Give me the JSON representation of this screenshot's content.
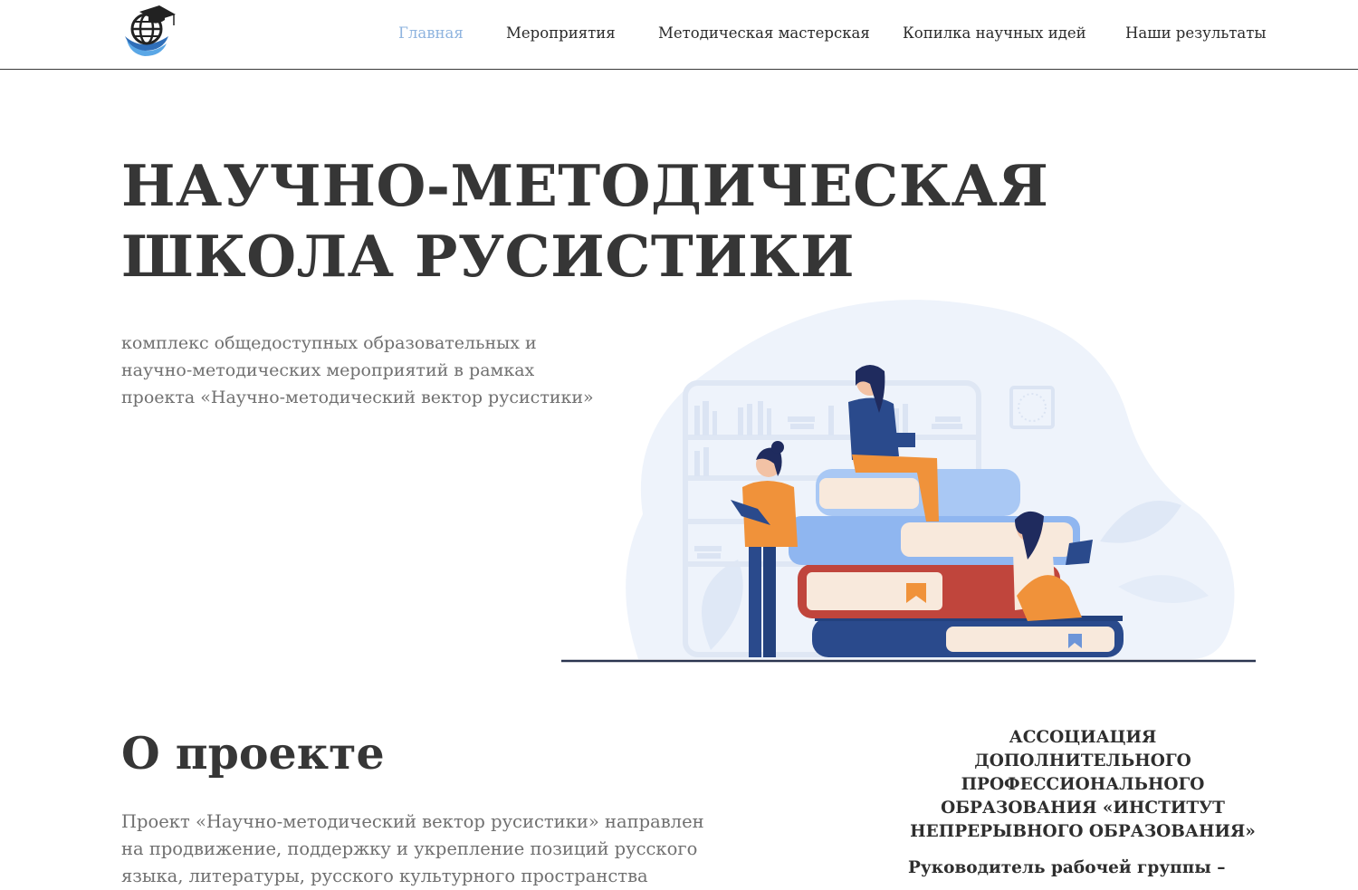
{
  "header": {
    "logo_icon": "globe-graduation-cap-icon",
    "nav": [
      {
        "label": "Главная",
        "active": true
      },
      {
        "label": "Мероприятия",
        "active": false
      },
      {
        "label": "Методическая мастерская",
        "active": false
      },
      {
        "label": "Копилка научных идей",
        "active": false
      },
      {
        "label": "Наши результаты",
        "active": false
      }
    ]
  },
  "hero": {
    "title_line1": "НАУЧНО-МЕТОДИЧЕСКАЯ",
    "title_line2": "ШКОЛА РУСИСТИКИ",
    "subtitle_line1": "комплекс общедоступных образовательных и",
    "subtitle_line2": "научно-методических мероприятий в рамках",
    "subtitle_line3": "проекта «Научно-методический вектор русистики»"
  },
  "about": {
    "title": "О проекте",
    "text_line1": "Проект «Научно-методический вектор русистики» направлен",
    "text_line2": "на продвижение, поддержку и укрепление позиций русского",
    "text_line3": "языка, литературы, русского культурного пространства"
  },
  "sidebar": {
    "assoc_line1": "АССОЦИАЦИЯ ДОПОЛНИТЕЛЬНОГО",
    "assoc_line2": "ПРОФЕССИОНАЛЬНОГО",
    "assoc_line3": "ОБРАЗОВАНИЯ «ИНСТИТУТ",
    "assoc_line4": "НЕПРЕРЫВНОГО ОБРАЗОВАНИЯ»",
    "leader_label": "Руководитель рабочей группы –"
  },
  "colors": {
    "accent": "#8fb4df",
    "text_dark": "#363636",
    "text_muted": "#707070",
    "illustration_blob": "#eef3fb",
    "book_blue": "#8fb6f0",
    "book_red": "#c0453c",
    "book_navy": "#2a4a8c",
    "figure_orange": "#f0923a"
  }
}
